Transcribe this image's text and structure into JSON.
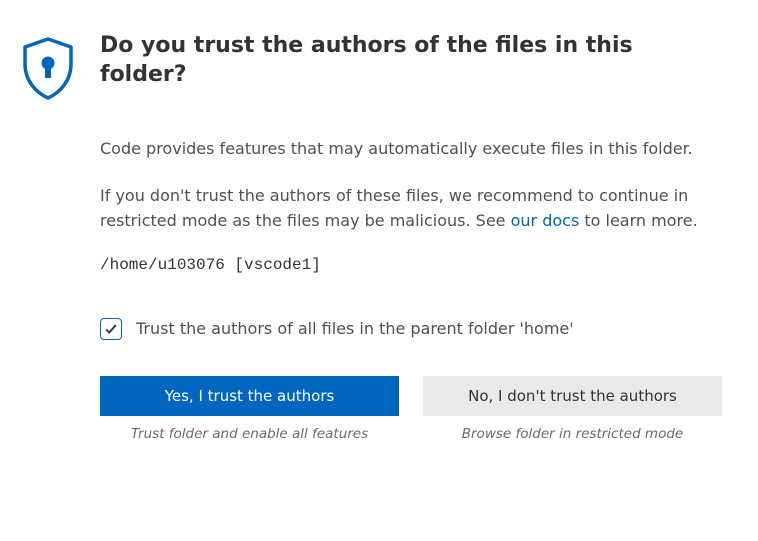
{
  "title": "Do you trust the authors of the files in this folder?",
  "paragraph1": "Code provides features that may automatically execute files in this folder.",
  "paragraph2_a": "If you don't trust the authors of these files, we recommend to continue in restricted mode as the files may be malicious. See ",
  "paragraph2_link": "our docs",
  "paragraph2_b": " to learn more.",
  "path": "/home/u103076 [vscode1]",
  "checkbox_checked": true,
  "checkbox_label": "Trust the authors of all files in the parent folder 'home'",
  "buttons": {
    "yes": {
      "label": "Yes, I trust the authors",
      "caption": "Trust folder and enable all features"
    },
    "no": {
      "label": "No, I don't trust the authors",
      "caption": "Browse folder in restricted mode"
    }
  },
  "colors": {
    "accent": "#0066bf"
  }
}
